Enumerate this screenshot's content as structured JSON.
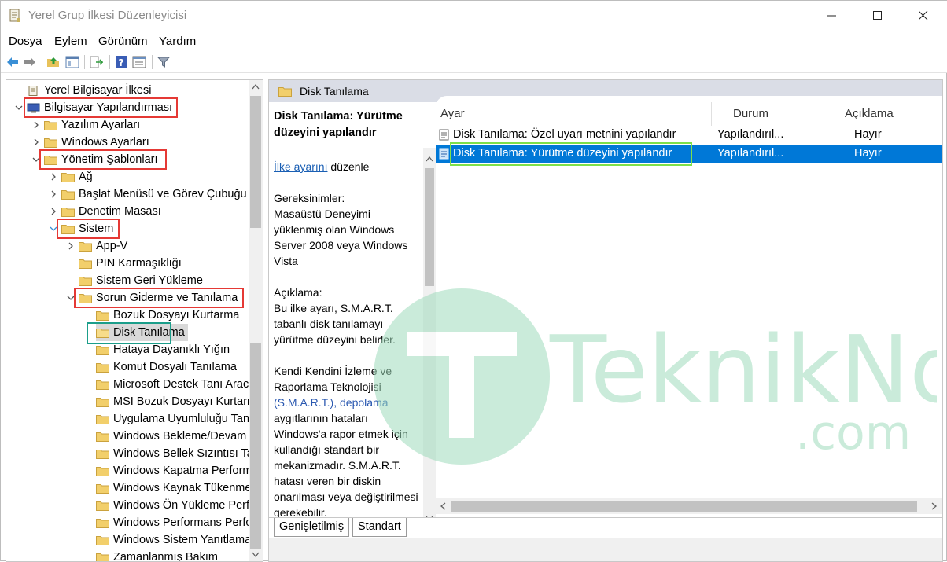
{
  "window": {
    "title": "Yerel Grup İlkesi Düzenleyicisi",
    "minimize_label": "—",
    "maximize_label": "☐",
    "close_label": "✕"
  },
  "menu": {
    "items": [
      "Dosya",
      "Eylem",
      "Görünüm",
      "Yardım"
    ]
  },
  "toolbar": {
    "icons": [
      "back-icon",
      "forward-icon",
      "up-folder-icon",
      "show-hide-tree-icon",
      "export-list-icon",
      "help-icon",
      "properties-icon",
      "filter-icon"
    ]
  },
  "tree": {
    "items": [
      {
        "label": "Yerel Bilgisayar İlkesi",
        "level": 0
      },
      {
        "label": "Bilgisayar Yapılandırması",
        "level": 0
      },
      {
        "label": "Yazılım Ayarları",
        "level": 1
      },
      {
        "label": "Windows Ayarları",
        "level": 1
      },
      {
        "label": "Yönetim Şablonları",
        "level": 1
      },
      {
        "label": "Ağ",
        "level": 2
      },
      {
        "label": "Başlat Menüsü ve Görev Çubuğu",
        "level": 2
      },
      {
        "label": "Denetim Masası",
        "level": 2
      },
      {
        "label": "Sistem",
        "level": 2
      },
      {
        "label": "App-V",
        "level": 3
      },
      {
        "label": "PIN Karmaşıklığı",
        "level": 3
      },
      {
        "label": "Sistem Geri Yükleme",
        "level": 3
      },
      {
        "label": "Sorun Giderme ve Tanılama",
        "level": 3
      },
      {
        "label": "Bozuk Dosyayı Kurtarma",
        "level": 4
      },
      {
        "label": "Disk Tanılama",
        "level": 4
      },
      {
        "label": "Hataya Dayanıklı Yığın",
        "level": 4
      },
      {
        "label": "Komut Dosyalı Tanılama",
        "level": 4
      },
      {
        "label": "Microsoft Destek Tanı Aracı",
        "level": 4
      },
      {
        "label": "MSI Bozuk Dosyayı Kurtarma",
        "level": 4
      },
      {
        "label": "Uygulama Uyumluluğu Tanılama",
        "level": 4
      },
      {
        "label": "Windows Bekleme/Devam Etme",
        "level": 4
      },
      {
        "label": "Windows Bellek Sızıntısı Tanılama",
        "level": 4
      },
      {
        "label": "Windows Kapatma Performansı",
        "level": 4
      },
      {
        "label": "Windows Kaynak Tükenmesi",
        "level": 4
      },
      {
        "label": "Windows Ön Yükleme Performansı",
        "level": 4
      },
      {
        "label": "Windows Performans Performansı",
        "level": 4
      },
      {
        "label": "Windows Sistem Yanıtlama",
        "level": 4
      },
      {
        "label": "Zamanlanmış Bakım",
        "level": 4
      }
    ]
  },
  "right": {
    "header": "Disk Tanılama",
    "description": {
      "title": "Disk Tanılama: Yürütme düzeyini yapılandır",
      "link": "İlke ayarını",
      "link_suffix": " düzenle",
      "requirements_label": "Gereksinimler:",
      "requirements_a": "Masaüstü Deneyimi yüklenmiş olan ",
      "requirements_b": "Windows Server 2008 veya Windows Vista",
      "explain_label": "Açıklama:",
      "explain_a": "Bu ilke ayarı, S.M.A.R.T. tabanlı disk tanılamayı yürütme düzeyini belirler.",
      "explain_b1": "Kendi Kendini İzleme ve Raporlama Teknolojisi ",
      "explain_b2": "(S.M.A.R.T.), depolama",
      "explain_b3": " aygıtlarının hataları Windows'a rapor etmek için kullandığı standart bir mekanizmadır. S.M.A.R.T. hatası veren bir diskin onarılması veya değiştirilmesi gerekebilir."
    },
    "columns": {
      "setting": "Ayar",
      "state": "Durum",
      "comment": "Açıklama"
    },
    "rows": [
      {
        "setting": "Disk Tanılama: Özel uyarı metnini yapılandır",
        "state": "Yapılandırıl...",
        "comment": "Hayır"
      },
      {
        "setting": "Disk Tanılama: Yürütme düzeyini yapılandır",
        "state": "Yapılandırıl...",
        "comment": "Hayır"
      }
    ],
    "tabs": [
      "Genişletilmiş",
      "Standart"
    ]
  },
  "watermark": {
    "brand": "TeknikNot",
    "suffix": ".com",
    "color": "#2eb872"
  }
}
